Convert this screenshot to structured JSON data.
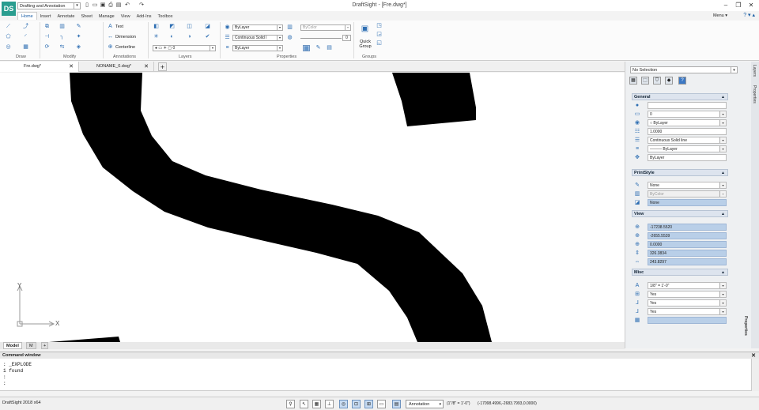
{
  "app": {
    "title": "DraftSight - [Fre.dwg*]",
    "logo": "DS",
    "workspace": "Drafting and Annotation"
  },
  "ribbon_tabs": [
    "Home",
    "Insert",
    "Annotate",
    "Sheet",
    "Manage",
    "View",
    "Add-Ins",
    "Toolbox"
  ],
  "menu_label": "Menu ▾",
  "ribbon": {
    "draw_label": "Draw",
    "modify_label": "Modify",
    "annotations_label": "Annotations",
    "layers_label": "Layers",
    "properties_label": "Properties",
    "groups_label": "Groups",
    "text_btn": "Text",
    "dimension_btn": "Dimension",
    "centerline_btn": "Centerline",
    "layer_value": "0",
    "color_value": "ByLayer",
    "linestyle_value": "Continuous",
    "linestyle_desc": "Solid l",
    "lineweight_value": "ByLayer",
    "transparency_value": "ByColor",
    "transparency_num": "0",
    "quick_group_label": "Quick Group"
  },
  "doc_tabs": [
    {
      "label": "Fre.dwg*",
      "active": true
    },
    {
      "label": "NONAME_0.dwg*",
      "active": false
    }
  ],
  "layout_tabs": [
    "Model",
    "M"
  ],
  "axis": {
    "y": "Y",
    "x": "X"
  },
  "palette": {
    "selection": "No Selection",
    "sections": {
      "general": "General",
      "printstyle": "PrintStyle",
      "view": "View",
      "misc": "Misc"
    },
    "general": [
      "",
      "0",
      "ByLayer",
      "1.0000",
      "Continuous    Solid line",
      "ByLayer",
      "ByLayer"
    ],
    "printstyle": [
      "None",
      "ByColor",
      "None"
    ],
    "view": [
      "-17238.5520",
      "-2655.5539",
      "0.0000",
      "326.3834",
      "243.8297"
    ],
    "misc": [
      "1/8\" = 1'-0\"",
      "Yes",
      "Yes",
      "Yes",
      ""
    ],
    "side_tabs": [
      "Layers",
      "Properties",
      "Properties"
    ]
  },
  "command": {
    "title": "Command window",
    "lines": [
      ": _EXPLODE",
      "1 found",
      ":",
      ":"
    ]
  },
  "status": {
    "version": "DraftSight 2018 x64",
    "annotation": "Annotation",
    "scale": "(1\"/8\" = 1'-0\")",
    "coords": "(-17098.4996,-2683.7993,0.0000)"
  },
  "colors": {
    "accent": "#1b5fa6",
    "highlight": "#b9cfe8",
    "logo": "#2a9d8f"
  }
}
